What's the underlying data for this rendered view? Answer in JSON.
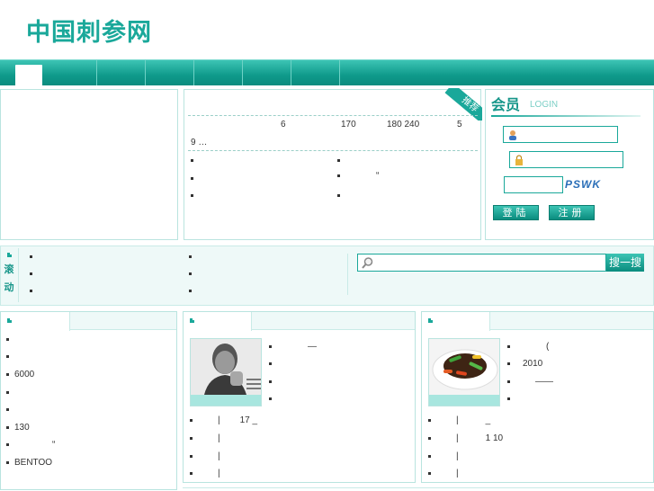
{
  "site": {
    "logo_text": "中国刺参网"
  },
  "nav": {
    "items": [
      "",
      "",
      "",
      "",
      "",
      "",
      ""
    ]
  },
  "featured": {
    "ribbon_label": "推荐",
    "summary_line1": "6 170 180 240 5",
    "summary_line2": "9 …",
    "quote_mark": "“"
  },
  "member": {
    "title": "会员",
    "subtitle": "LOGIN",
    "username_value": "",
    "password_value": "",
    "captcha_value": "",
    "captcha_text": "PSWK",
    "login_label": "登陆",
    "register_label": "注册"
  },
  "ticker": {
    "label": "滚动",
    "search_placeholder": "",
    "search_button": "搜一搜"
  },
  "left_list": {
    "items": [
      "",
      "",
      "6000",
      "",
      "",
      "130",
      "“",
      "BENTOO"
    ]
  },
  "mid_panel": {
    "photo_items": [
      "—",
      "",
      "",
      ""
    ],
    "rows": [
      {
        "sep": "|",
        "text": "17 _"
      },
      {
        "sep": "|",
        "text": ""
      },
      {
        "sep": "|",
        "text": ""
      },
      {
        "sep": "|",
        "text": ""
      }
    ]
  },
  "right_panel": {
    "photo_items": [
      "(",
      "2010",
      "——",
      ""
    ],
    "rows": [
      {
        "sep": "|",
        "text": "_"
      },
      {
        "sep": "|",
        "text": "1 10"
      },
      {
        "sep": "|",
        "text": ""
      },
      {
        "sep": "|",
        "text": ""
      }
    ]
  },
  "colors": {
    "accent": "#1aa89a",
    "accent_dark": "#0a8c7e",
    "light_bg": "#eef9f8",
    "border": "#b9e4df"
  },
  "icons": {
    "user": "user-icon",
    "lock": "lock-icon",
    "search": "search-icon"
  }
}
